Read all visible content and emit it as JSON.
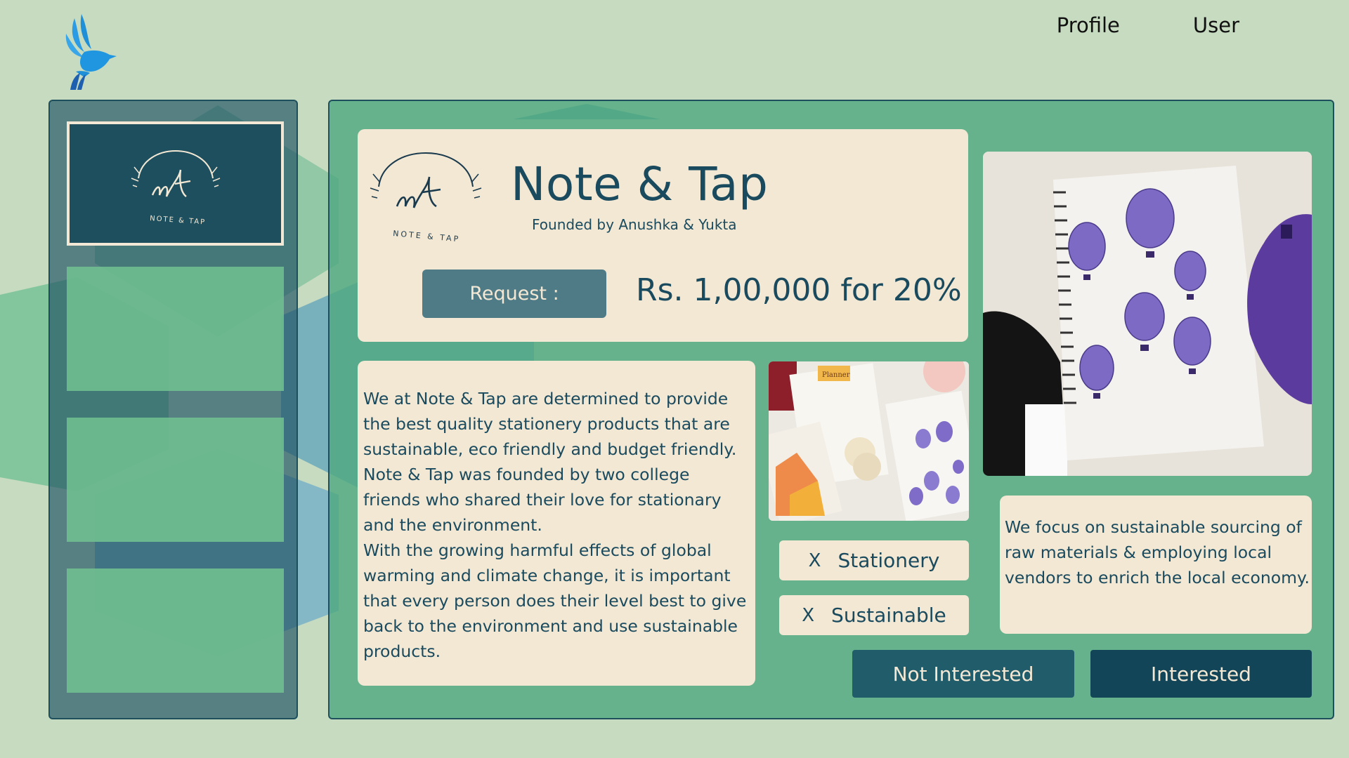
{
  "nav": {
    "profile_label": "Profile",
    "user_label": "User"
  },
  "sidebar": {
    "active_logo_text": "NOTE & TAP",
    "cards": [
      "",
      "",
      ""
    ]
  },
  "startup": {
    "name": "Note & Tap",
    "founders": "Founded by Anushka & Yukta",
    "logo_text": "NOTE & TAP",
    "request_label": "Request :",
    "request_amount": "Rs. 1,00,000 for 20%",
    "description": [
      "We at Note & Tap are determined to provide the best quality stationery products that are sustainable, eco friendly and budget friendly. Note & Tap was founded by two college friends who shared their love for stationary and the environment.",
      "With the growing harmful effects of global warming and climate change, it is important that every person does their level best to give back to the environment and use sustainable products."
    ],
    "tags": [
      {
        "remove": "X",
        "label": "Stationery"
      },
      {
        "remove": "X",
        "label": "Sustainable"
      }
    ],
    "focus": "We focus on sustainable sourcing of raw materials & employing local vendors to enrich the local economy.",
    "thumb_label": "Planner"
  },
  "actions": {
    "not_interested": "Not Interested",
    "interested": "Interested"
  },
  "colors": {
    "background": "#c6dbc0",
    "panel": "#4fa880",
    "card": "#f3e8d4",
    "text": "#1a4a5e",
    "accent_dark": "#124558",
    "bird": "#2196e0"
  },
  "icons": {
    "brand_logo": "bird-icon",
    "remove_tag": "close-x"
  }
}
